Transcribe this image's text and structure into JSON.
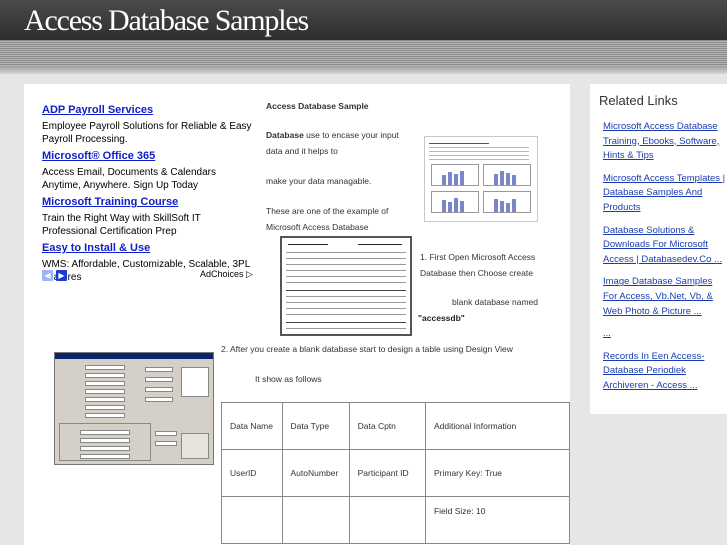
{
  "site": {
    "title": "Access Database Samples"
  },
  "ads": [
    {
      "title": "ADP Payroll Services",
      "desc": "Employee Payroll Solutions for Reliable & Easy Payroll Processing."
    },
    {
      "title": "Microsoft® Office 365",
      "desc": "Access Email, Documents & Calendars Anytime, Anywhere. Sign Up Today"
    },
    {
      "title": "Microsoft Training Course",
      "desc": "Train the Right Way with SkillSoft IT Professional Certification Prep"
    },
    {
      "title": "Easy to Install & Use",
      "desc": "WMS: Affordable, Customizable, Scalable, 3PL Features"
    }
  ],
  "adchoices": "AdChoices",
  "article": {
    "heading": "Access Database Sample",
    "intro_bold": "Database",
    "intro_rest": " use to encase your input",
    "intro_line2": "data and it helps to",
    "line3": "make your data managable.",
    "line4": "These are one of the example of",
    "line5": "Microsoft Access Database",
    "step1_line1": "1. First Open Microsoft Access",
    "step1_line2": "Database then Choose create",
    "step1_line3": "blank database named",
    "step1_name": "\"accessdb\"",
    "step2": "2. After  you create a blank database  start to design a table using Design View",
    "step2_sub": "It show as follows"
  },
  "design_table": {
    "headers": [
      "Data Name",
      "Data Type",
      "Data Cptn",
      "Additional Information"
    ],
    "rows": [
      [
        "UserID",
        "AutoNumber",
        "Participant ID",
        "Primary Key: True"
      ],
      [
        "",
        "",
        "",
        "Field Size: 10"
      ]
    ]
  },
  "sidebar": {
    "title": "Related Links",
    "links": [
      "Microsoft Access Database Training, Ebooks, Software, Hints & Tips",
      "Microsoft Access Templates | Database Samples And Products",
      "Database Solutions & Downloads For Microsoft Access | Databasedev.Co ...",
      "Image Database Samples For Access, Vb.Net, Vb, & Web Photo & Picture ...",
      "...",
      "Records In Een Access-Database Periodiek Archiveren - Access ..."
    ]
  }
}
